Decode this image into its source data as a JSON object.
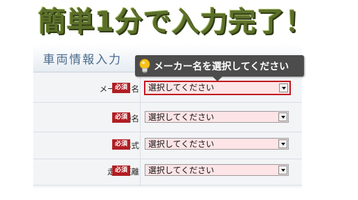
{
  "headline": "簡単1分で入力完了！",
  "section": {
    "title": "車両情報入力"
  },
  "tooltip": {
    "text": "メーカー名を選択してください"
  },
  "required_label": "必須",
  "fields": [
    {
      "label": "メーカー名",
      "value": "選択してください"
    },
    {
      "label": "車種名",
      "value": "選択してください"
    },
    {
      "label": "年式",
      "value": "選択してください"
    },
    {
      "label": "走行距離",
      "value": "選択してください"
    }
  ],
  "colors": {
    "headline": "#5b6f2a",
    "required_badge": "#b01e23",
    "select_bg": "#fde4e6",
    "active_border": "#c0181d"
  }
}
